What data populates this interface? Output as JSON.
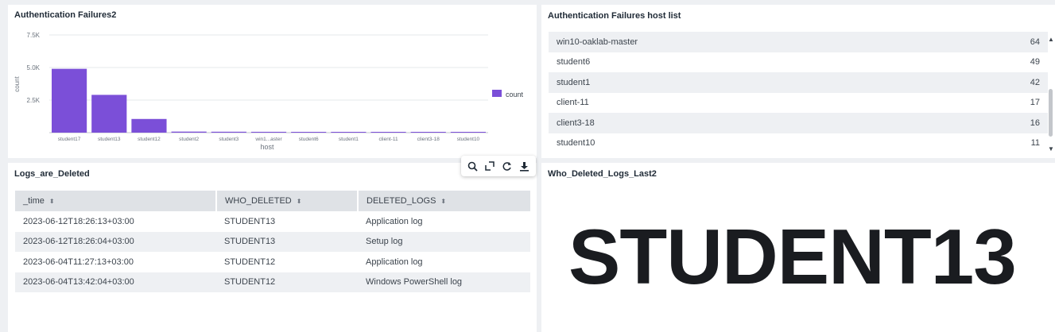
{
  "panels": {
    "chart": {
      "title": "Authentication Failures2",
      "legend_label": "count",
      "y_axis_label": "count",
      "x_axis_label": "host",
      "y_ticks": [
        "2.5K",
        "5.0K",
        "7.5K"
      ]
    },
    "hosts": {
      "title": "Authentication Failures host list",
      "rows": [
        {
          "host": "win10-oaklab-master",
          "count": "64"
        },
        {
          "host": "student6",
          "count": "49"
        },
        {
          "host": "student1",
          "count": "42"
        },
        {
          "host": "client-11",
          "count": "17"
        },
        {
          "host": "client3-18",
          "count": "16"
        },
        {
          "host": "student10",
          "count": "11"
        }
      ]
    },
    "logs": {
      "title": "Logs_are_Deleted",
      "columns": [
        "_time",
        "WHO_DELETED",
        "DELETED_LOGS"
      ],
      "sort_glyph": "⬍",
      "rows": [
        [
          "2023-06-12T18:26:13+03:00",
          "STUDENT13",
          "Application log"
        ],
        [
          "2023-06-12T18:26:04+03:00",
          "STUDENT13",
          "Setup log"
        ],
        [
          "2023-06-04T11:27:13+03:00",
          "STUDENT12",
          "Application log"
        ],
        [
          "2023-06-04T13:42:04+03:00",
          "STUDENT12",
          "Windows PowerShell log"
        ]
      ]
    },
    "single": {
      "title": "Who_Deleted_Logs_Last2",
      "value": "STUDENT13"
    }
  },
  "chart_data": {
    "type": "bar",
    "categories": [
      "student17",
      "student13",
      "student12",
      "student2",
      "student3",
      "win1...aster",
      "student6",
      "student1",
      "client-11",
      "client3-18",
      "student10"
    ],
    "series": [
      {
        "name": "count",
        "values": [
          4900,
          2900,
          1050,
          80,
          70,
          64,
          49,
          42,
          17,
          16,
          11
        ]
      }
    ],
    "title": "Authentication Failures2",
    "xlabel": "host",
    "ylabel": "count",
    "ylim": [
      0,
      7500
    ],
    "grid": true,
    "legend": "right",
    "color": "#7b4fd8"
  },
  "colors": {
    "bar": "#7b4fd8",
    "alt_row": "#eef0f3",
    "header": "#dfe2e6"
  }
}
